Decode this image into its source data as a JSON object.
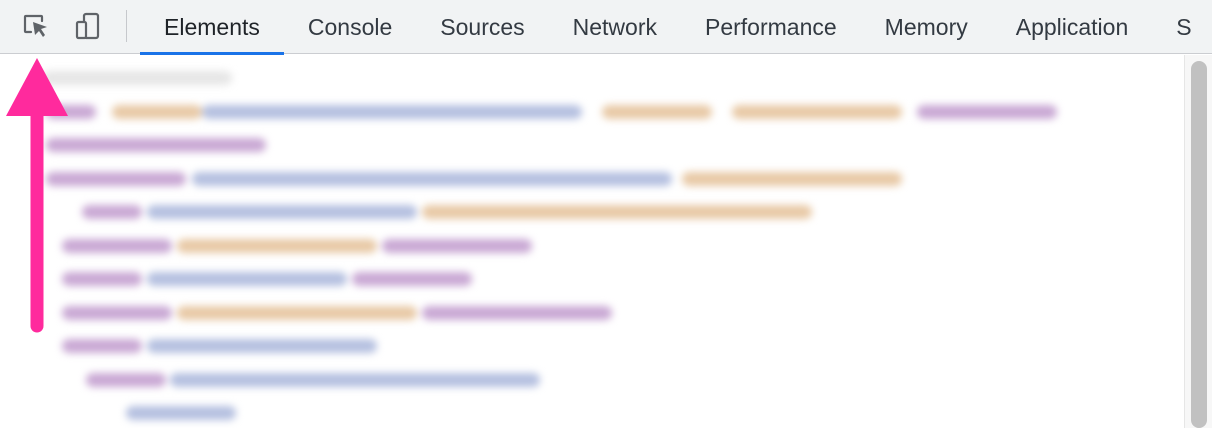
{
  "toolbar": {
    "inspect_icon": "select-element-icon",
    "device_icon": "device-toggle-icon"
  },
  "tabs": [
    {
      "label": "Elements",
      "active": true
    },
    {
      "label": "Console",
      "active": false
    },
    {
      "label": "Sources",
      "active": false
    },
    {
      "label": "Network",
      "active": false
    },
    {
      "label": "Performance",
      "active": false
    },
    {
      "label": "Memory",
      "active": false
    },
    {
      "label": "Application",
      "active": false
    }
  ],
  "tabs_overflow": "S",
  "colors": {
    "active_tab_underline": "#1a73e8",
    "annotation_arrow": "#ff2a9d",
    "tag": "#8e3fa6",
    "attr_name": "#c7853a",
    "attr_value": "#2f4fa8"
  }
}
